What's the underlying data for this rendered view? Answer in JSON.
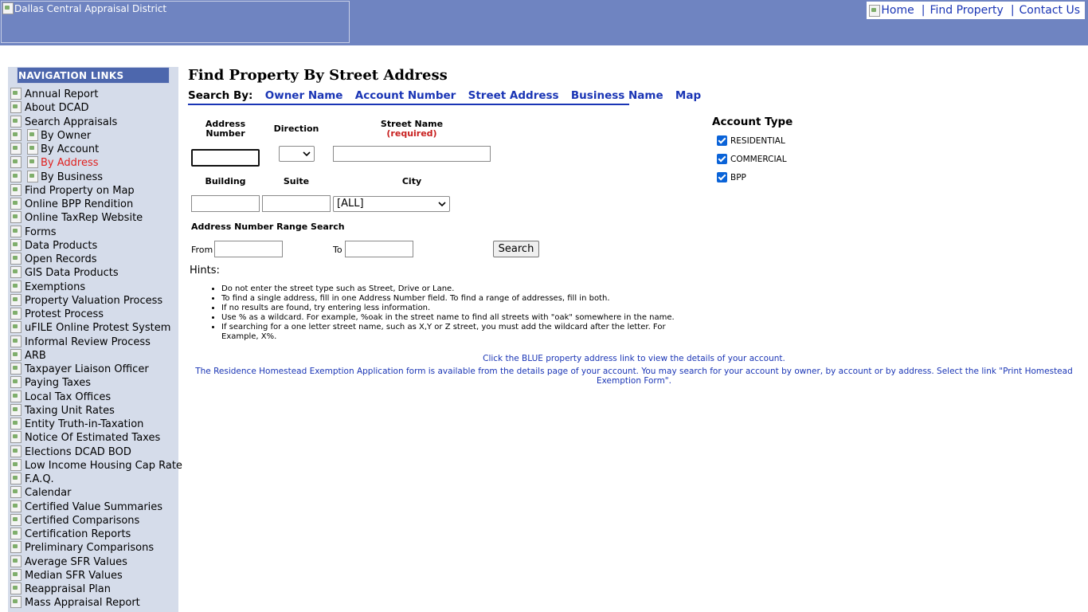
{
  "header": {
    "logo_alt": "Dallas Central Appraisal District",
    "links": {
      "home": "Home",
      "find_property": "Find Property",
      "contact_us": "Contact Us",
      "separator": "|"
    }
  },
  "sidebar": {
    "title": "NAVIGATION LINKS",
    "items": [
      {
        "label": "Annual Report"
      },
      {
        "label": "About DCAD"
      },
      {
        "label": "Search Appraisals"
      },
      {
        "label": "By Owner",
        "sub": true
      },
      {
        "label": "By Account",
        "sub": true
      },
      {
        "label": "By Address",
        "sub": true,
        "active": true
      },
      {
        "label": "By Business",
        "sub": true
      },
      {
        "label": "Find Property on Map"
      },
      {
        "label": "Online BPP Rendition"
      },
      {
        "label": "Online TaxRep Website"
      },
      {
        "label": "Forms"
      },
      {
        "label": "Data Products"
      },
      {
        "label": "Open Records"
      },
      {
        "label": "GIS Data Products"
      },
      {
        "label": "Exemptions"
      },
      {
        "label": "Property Valuation Process"
      },
      {
        "label": "Protest Process"
      },
      {
        "label": "uFILE Online Protest System"
      },
      {
        "label": "Informal Review Process"
      },
      {
        "label": "ARB"
      },
      {
        "label": "Taxpayer Liaison Officer"
      },
      {
        "label": "Paying Taxes"
      },
      {
        "label": "Local Tax Offices"
      },
      {
        "label": "Taxing Unit Rates"
      },
      {
        "label": "Entity Truth-in-Taxation"
      },
      {
        "label": "Notice Of Estimated Taxes"
      },
      {
        "label": "Elections DCAD BOD"
      },
      {
        "label": "Low Income Housing Cap Rate"
      },
      {
        "label": "F.A.Q."
      },
      {
        "label": "Calendar"
      },
      {
        "label": "Certified Value Summaries"
      },
      {
        "label": "Certified Comparisons"
      },
      {
        "label": "Certification Reports"
      },
      {
        "label": "Preliminary Comparisons"
      },
      {
        "label": "Average SFR Values"
      },
      {
        "label": "Median SFR Values"
      },
      {
        "label": "Reappraisal Plan"
      },
      {
        "label": "Mass Appraisal Report"
      }
    ]
  },
  "main": {
    "title": "Find Property By Street Address",
    "search_by": {
      "label": "Search By:",
      "links": [
        "Owner Name",
        "Account Number",
        "Street Address",
        "Business Name",
        "Map"
      ]
    },
    "form": {
      "address_number_label_1": "Address",
      "address_number_label_2": "Number",
      "direction_label": "Direction",
      "street_name_label": "Street Name",
      "street_name_required": "(required)",
      "building_label": "Building",
      "suite_label": "Suite",
      "city_label": "City",
      "city_value": "[ALL]",
      "direction_value": "",
      "range_title": "Address Number Range Search",
      "from_label": "From",
      "to_label": "To",
      "search_button": "Search"
    },
    "hints": {
      "title": "Hints:",
      "items": [
        "Do not enter the street type such as Street, Drive or Lane.",
        "To find a single address, fill in one Address Number field. To find a range of addresses, fill in both.",
        "If no results are found, try entering less information.",
        "Use % as a wildcard. For example, %oak in the street name to find all streets with \"oak\" somewhere in the name.",
        "If searching for a one letter street name, such as X,Y or Z street, you must add the wildcard after the letter. For Example, X%."
      ]
    },
    "notes": {
      "click_blue": "Click the BLUE property address link to view the details of your account.",
      "homestead": "The Residence Homestead Exemption Application form is available from the details page of your account. You may search for your account by owner, by account or by address. Select the link \"Print Homestead Exemption Form\"."
    },
    "account_type": {
      "title": "Account Type",
      "options": [
        {
          "label": "RESIDENTIAL",
          "checked": true
        },
        {
          "label": "COMMERCIAL",
          "checked": true
        },
        {
          "label": "BPP",
          "checked": true
        }
      ]
    }
  }
}
